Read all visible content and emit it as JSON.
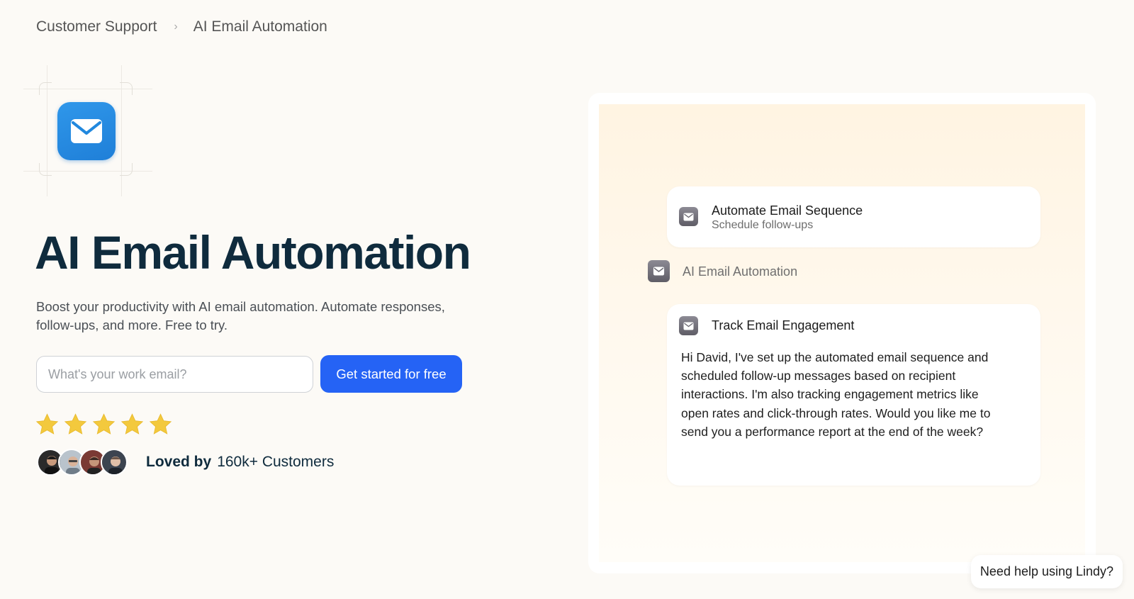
{
  "breadcrumb": {
    "parent": "Customer Support",
    "separator": "›",
    "current": "AI Email Automation"
  },
  "hero": {
    "icon": "mail-icon",
    "title": "AI Email Automation",
    "subtitle": "Boost your productivity with AI email automation. Automate responses, follow-ups, and more. Free to try.",
    "email_placeholder": "What's your work email?",
    "cta_label": "Get started for free"
  },
  "social_proof": {
    "rating": 5,
    "rating_max": 5,
    "loved_label": "Loved by",
    "customers": "160k+ Customers",
    "star_color": "#f3c93d"
  },
  "preview": {
    "card1": {
      "icon": "mail-icon",
      "title": "Automate Email Sequence",
      "subtitle": "Schedule follow-ups"
    },
    "status": {
      "icon": "mail-icon",
      "label": "AI Email Automation"
    },
    "card2": {
      "icon": "mail-icon",
      "title": "Track Email Engagement",
      "message": "Hi David, I've set up the automated email sequence and scheduled follow-up messages based on recipient interactions. I'm also tracking engagement metrics like open rates and click-through rates. Would you like me to send you a performance report at the end of the week?"
    }
  },
  "help": {
    "label": "Need help using Lindy?"
  },
  "colors": {
    "accent": "#2563f5",
    "heading": "#0f2b3d",
    "app_icon": "#2f97ea"
  }
}
